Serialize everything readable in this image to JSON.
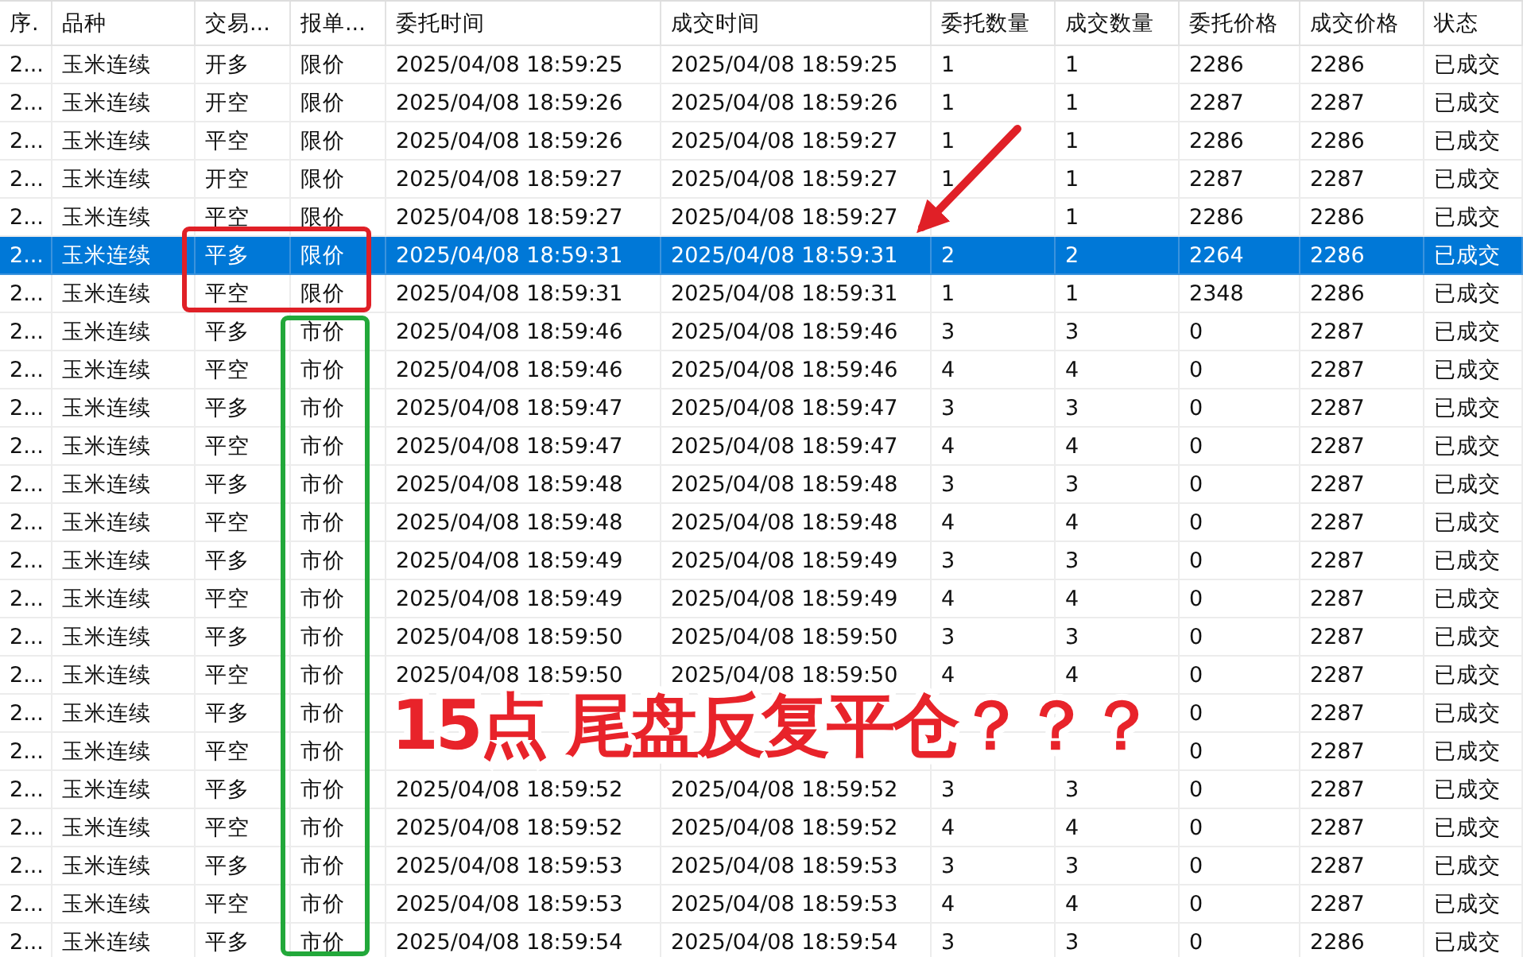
{
  "table": {
    "columns": [
      "序.",
      "品种",
      "交易...",
      "报单...",
      "委托时间",
      "成交时间",
      "委托数量",
      "成交数量",
      "委托价格",
      "成交价格",
      "状态"
    ],
    "rows": [
      {
        "cells": [
          "2...",
          "玉米连续",
          "开多",
          "限价",
          "2025/04/08 18:59:25",
          "2025/04/08 18:59:25",
          "1",
          "1",
          "2286",
          "2286",
          "已成交"
        ],
        "selected": false
      },
      {
        "cells": [
          "2...",
          "玉米连续",
          "开空",
          "限价",
          "2025/04/08 18:59:26",
          "2025/04/08 18:59:26",
          "1",
          "1",
          "2287",
          "2287",
          "已成交"
        ],
        "selected": false
      },
      {
        "cells": [
          "2...",
          "玉米连续",
          "平空",
          "限价",
          "2025/04/08 18:59:26",
          "2025/04/08 18:59:27",
          "1",
          "1",
          "2286",
          "2286",
          "已成交"
        ],
        "selected": false
      },
      {
        "cells": [
          "2...",
          "玉米连续",
          "开空",
          "限价",
          "2025/04/08 18:59:27",
          "2025/04/08 18:59:27",
          "1",
          "1",
          "2287",
          "2287",
          "已成交"
        ],
        "selected": false
      },
      {
        "cells": [
          "2...",
          "玉米连续",
          "平空",
          "限价",
          "2025/04/08 18:59:27",
          "2025/04/08 18:59:27",
          null,
          "1",
          "2286",
          "2286",
          "已成交"
        ],
        "selected": false
      },
      {
        "cells": [
          "2...",
          "玉米连续",
          "平多",
          "限价",
          "2025/04/08 18:59:31",
          "2025/04/08 18:59:31",
          "2",
          "2",
          "2264",
          "2286",
          "已成交"
        ],
        "selected": true
      },
      {
        "cells": [
          "2...",
          "玉米连续",
          "平空",
          "限价",
          "2025/04/08 18:59:31",
          "2025/04/08 18:59:31",
          "1",
          "1",
          "2348",
          "2286",
          "已成交"
        ],
        "selected": false
      },
      {
        "cells": [
          "2...",
          "玉米连续",
          "平多",
          "市价",
          "2025/04/08 18:59:46",
          "2025/04/08 18:59:46",
          "3",
          "3",
          "0",
          "2287",
          "已成交"
        ],
        "selected": false
      },
      {
        "cells": [
          "2...",
          "玉米连续",
          "平空",
          "市价",
          "2025/04/08 18:59:46",
          "2025/04/08 18:59:46",
          "4",
          "4",
          "0",
          "2287",
          "已成交"
        ],
        "selected": false
      },
      {
        "cells": [
          "2...",
          "玉米连续",
          "平多",
          "市价",
          "2025/04/08 18:59:47",
          "2025/04/08 18:59:47",
          "3",
          "3",
          "0",
          "2287",
          "已成交"
        ],
        "selected": false
      },
      {
        "cells": [
          "2...",
          "玉米连续",
          "平空",
          "市价",
          "2025/04/08 18:59:47",
          "2025/04/08 18:59:47",
          "4",
          "4",
          "0",
          "2287",
          "已成交"
        ],
        "selected": false
      },
      {
        "cells": [
          "2...",
          "玉米连续",
          "平多",
          "市价",
          "2025/04/08 18:59:48",
          "2025/04/08 18:59:48",
          "3",
          "3",
          "0",
          "2287",
          "已成交"
        ],
        "selected": false
      },
      {
        "cells": [
          "2...",
          "玉米连续",
          "平空",
          "市价",
          "2025/04/08 18:59:48",
          "2025/04/08 18:59:48",
          "4",
          "4",
          "0",
          "2287",
          "已成交"
        ],
        "selected": false
      },
      {
        "cells": [
          "2...",
          "玉米连续",
          "平多",
          "市价",
          "2025/04/08 18:59:49",
          "2025/04/08 18:59:49",
          "3",
          "3",
          "0",
          "2287",
          "已成交"
        ],
        "selected": false
      },
      {
        "cells": [
          "2...",
          "玉米连续",
          "平空",
          "市价",
          "2025/04/08 18:59:49",
          "2025/04/08 18:59:49",
          "4",
          "4",
          "0",
          "2287",
          "已成交"
        ],
        "selected": false
      },
      {
        "cells": [
          "2...",
          "玉米连续",
          "平多",
          "市价",
          "2025/04/08 18:59:50",
          "2025/04/08 18:59:50",
          "3",
          "3",
          "0",
          "2287",
          "已成交"
        ],
        "selected": false
      },
      {
        "cells": [
          "2...",
          "玉米连续",
          "平空",
          "市价",
          "2025/04/08 18:59:50",
          "2025/04/08 18:59:50",
          "4",
          "4",
          "0",
          "2287",
          "已成交"
        ],
        "selected": false
      },
      {
        "cells": [
          "2...",
          "玉米连续",
          "平多",
          "市价",
          null,
          null,
          null,
          null,
          "0",
          "2287",
          "已成交"
        ],
        "selected": false
      },
      {
        "cells": [
          "2...",
          "玉米连续",
          "平空",
          "市价",
          null,
          null,
          null,
          null,
          "0",
          "2287",
          "已成交"
        ],
        "selected": false
      },
      {
        "cells": [
          "2...",
          "玉米连续",
          "平多",
          "市价",
          "2025/04/08 18:59:52",
          "2025/04/08 18:59:52",
          "3",
          "3",
          "0",
          "2287",
          "已成交"
        ],
        "selected": false
      },
      {
        "cells": [
          "2...",
          "玉米连续",
          "平空",
          "市价",
          "2025/04/08 18:59:52",
          "2025/04/08 18:59:52",
          "4",
          "4",
          "0",
          "2287",
          "已成交"
        ],
        "selected": false
      },
      {
        "cells": [
          "2...",
          "玉米连续",
          "平多",
          "市价",
          "2025/04/08 18:59:53",
          "2025/04/08 18:59:53",
          "3",
          "3",
          "0",
          "2287",
          "已成交"
        ],
        "selected": false
      },
      {
        "cells": [
          "2...",
          "玉米连续",
          "平空",
          "市价",
          "2025/04/08 18:59:53",
          "2025/04/08 18:59:53",
          "4",
          "4",
          "0",
          "2287",
          "已成交"
        ],
        "selected": false
      },
      {
        "cells": [
          "2...",
          "玉米连续",
          "平多",
          "市价",
          "2025/04/08 18:59:54",
          "2025/04/08 18:59:54",
          "3",
          "3",
          "0",
          "2286",
          "已成交"
        ],
        "selected": false
      }
    ]
  },
  "annotation": {
    "text": "15点 尾盘反复平仓？？？"
  }
}
